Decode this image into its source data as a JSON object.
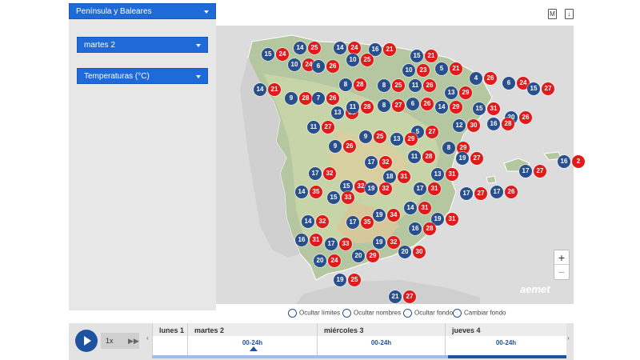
{
  "controls": {
    "region": "Península y Baleares",
    "day": "martes 2",
    "variable": "Temperaturas (°C)"
  },
  "top_icons": [
    "M",
    "↓"
  ],
  "map": {
    "attribution": "aemet",
    "zoom_in": "+",
    "zoom_out": "−",
    "temperature_pairs": [
      {
        "min": "15",
        "max": "24"
      },
      {
        "min": "14",
        "max": "25"
      },
      {
        "min": "14",
        "max": "24"
      },
      {
        "min": "16",
        "max": "21"
      },
      {
        "min": "15",
        "max": "21"
      },
      {
        "min": "10",
        "max": "24"
      },
      {
        "min": "6",
        "max": "26"
      },
      {
        "min": "10",
        "max": "25"
      },
      {
        "min": "10",
        "max": "23"
      },
      {
        "min": "5",
        "max": "21"
      },
      {
        "min": "4",
        "max": "26"
      },
      {
        "min": "6",
        "max": "24"
      },
      {
        "min": "15",
        "max": "27"
      },
      {
        "min": "14",
        "max": "21"
      },
      {
        "min": "8",
        "max": "28"
      },
      {
        "min": "8",
        "max": "25"
      },
      {
        "min": "11",
        "max": "26"
      },
      {
        "min": "13",
        "max": "29"
      },
      {
        "min": "9",
        "max": "28"
      },
      {
        "min": "7",
        "max": "26"
      },
      {
        "min": "13",
        "max": "30"
      },
      {
        "min": "11",
        "max": "28"
      },
      {
        "min": "8",
        "max": "27"
      },
      {
        "min": "6",
        "max": "26"
      },
      {
        "min": "14",
        "max": "29"
      },
      {
        "min": "15",
        "max": "31"
      },
      {
        "min": "20",
        "max": "26"
      },
      {
        "min": "16",
        "max": "28"
      },
      {
        "min": "11",
        "max": "27"
      },
      {
        "min": "5",
        "max": "27"
      },
      {
        "min": "12",
        "max": "30"
      },
      {
        "min": "9",
        "max": "25"
      },
      {
        "min": "13",
        "max": "29"
      },
      {
        "min": "9",
        "max": "26"
      },
      {
        "min": "8",
        "max": "29"
      },
      {
        "min": "11",
        "max": "28"
      },
      {
        "min": "19",
        "max": "27"
      },
      {
        "min": "17",
        "max": "32"
      },
      {
        "min": "17",
        "max": "27"
      },
      {
        "min": "16",
        "max": "2"
      },
      {
        "min": "17",
        "max": "32"
      },
      {
        "min": "18",
        "max": "31"
      },
      {
        "min": "13",
        "max": "31"
      },
      {
        "min": "15",
        "max": "32"
      },
      {
        "min": "19",
        "max": "32"
      },
      {
        "min": "17",
        "max": "31"
      },
      {
        "min": "17",
        "max": "27"
      },
      {
        "min": "17",
        "max": "26"
      },
      {
        "min": "14",
        "max": "35"
      },
      {
        "min": "15",
        "max": "33"
      },
      {
        "min": "14",
        "max": "31"
      },
      {
        "min": "19",
        "max": "34"
      },
      {
        "min": "14",
        "max": "32"
      },
      {
        "min": "17",
        "max": "35"
      },
      {
        "min": "19",
        "max": "31"
      },
      {
        "min": "16",
        "max": "28"
      },
      {
        "min": "16",
        "max": "31"
      },
      {
        "min": "17",
        "max": "33"
      },
      {
        "min": "19",
        "max": "32"
      },
      {
        "min": "20",
        "max": "24"
      },
      {
        "min": "20",
        "max": "29"
      },
      {
        "min": "20",
        "max": "30"
      },
      {
        "min": "19",
        "max": "25"
      },
      {
        "min": "21",
        "max": "27"
      }
    ]
  },
  "options": [
    {
      "label": "Ocultar límites"
    },
    {
      "label": "Ocultar nombres"
    },
    {
      "label": "Ocultar fondo"
    },
    {
      "label": "Cambiar fondo"
    }
  ],
  "timeline": {
    "speed": "1x",
    "days": [
      {
        "name": "lunes 1",
        "hours": ""
      },
      {
        "name": "martes 2",
        "hours": "00-24h"
      },
      {
        "name": "miércoles 3",
        "hours": "00-24h"
      },
      {
        "name": "jueves 4",
        "hours": "00-24h"
      }
    ]
  }
}
